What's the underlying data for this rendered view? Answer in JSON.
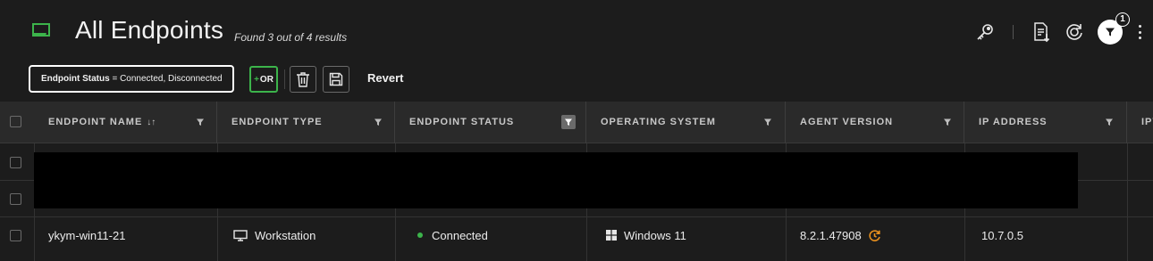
{
  "header": {
    "title": "All Endpoints",
    "subtitle": "Found 3 out of 4 results",
    "filter_count": "1",
    "accent_color": "#3cb44b"
  },
  "filter_bar": {
    "chip_field": "Endpoint Status",
    "chip_operator": "=",
    "chip_values": "Connected, Disconnected",
    "or_label": "OR",
    "revert_label": "Revert"
  },
  "table": {
    "columns": [
      {
        "label": "ENDPOINT NAME",
        "sort": "↓↑"
      },
      {
        "label": "ENDPOINT TYPE"
      },
      {
        "label": "ENDPOINT STATUS",
        "filtered": true
      },
      {
        "label": "OPERATING SYSTEM"
      },
      {
        "label": "AGENT VERSION"
      },
      {
        "label": "IP ADDRESS"
      },
      {
        "label": "IPV"
      }
    ],
    "rows": [
      {
        "name": "ykym-win11-21",
        "type": "Workstation",
        "status": "Connected",
        "os": "Windows 11",
        "agent_version": "8.2.1.47908",
        "ip": "10.7.0.5"
      }
    ],
    "status_color": "#3cb44b",
    "update_icon_color": "#e8901e"
  }
}
